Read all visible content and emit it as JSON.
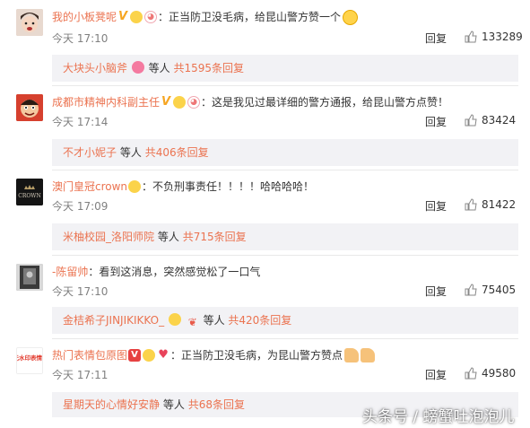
{
  "comments": [
    {
      "username": "我的小板凳呢",
      "text": "：正当防卫没毛病，给昆山警方赞一个",
      "time": "今天 17:10",
      "reply_label": "回复",
      "likes": "133289",
      "sub": {
        "name": "大块头小脑斧",
        "deng": "等人",
        "total": "共1595条回复"
      }
    },
    {
      "username": "成都市精神内科副主任",
      "text": "：这是我见过最详细的警方通报，给昆山警方点赞！",
      "time": "今天 17:14",
      "reply_label": "回复",
      "likes": "83424",
      "sub": {
        "name": "不才小妮子",
        "deng": "等人",
        "total": "共406条回复"
      }
    },
    {
      "username": "澳门皇冠crown",
      "text": "：不负刑事责任！！！！哈哈哈哈！",
      "time": "今天 17:09",
      "reply_label": "回复",
      "likes": "81422",
      "sub": {
        "name": "米柚校园_洛阳师院",
        "deng": "等人",
        "total": "共715条回复"
      }
    },
    {
      "username": "-陈留帅",
      "text": "：看到这消息，突然感觉松了一口气",
      "time": "今天 17:10",
      "reply_label": "回复",
      "likes": "75405",
      "sub": {
        "name": "金桔希子JINJIKIKKO_",
        "deng": "等人",
        "total": "共420条回复"
      }
    },
    {
      "username": "热门表情包原图",
      "text": "：正当防卫没毛病，为昆山警方赞点",
      "time": "今天 17:11",
      "reply_label": "回复",
      "likes": "49580",
      "sub": {
        "name": "星期天的心情好安静",
        "deng": "等人",
        "total": "共68条回复"
      }
    }
  ],
  "avatars": {
    "a3": "CROWN",
    "a5": "无水印表情包"
  },
  "watermark": "头条号 / 螃蟹吐泡泡儿",
  "colors": {
    "username": "#eb7350",
    "time": "#808080",
    "sub_bg": "#f2f2f5"
  }
}
